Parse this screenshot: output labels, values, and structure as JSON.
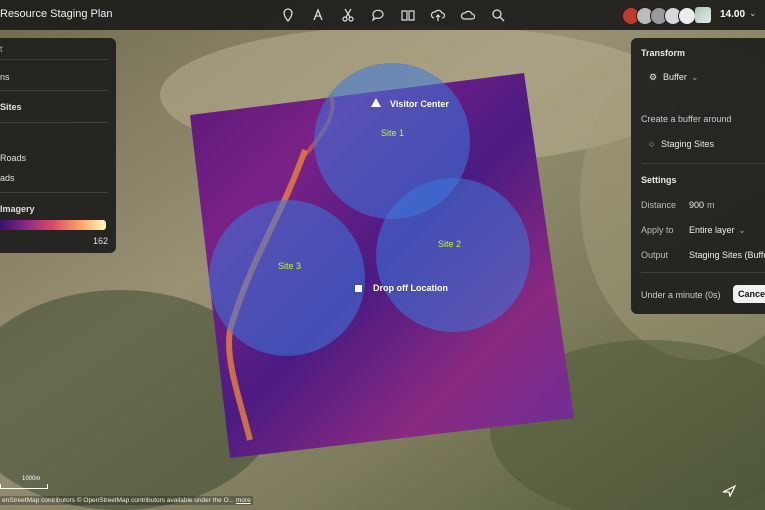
{
  "app": {
    "title": "Resource Staging Plan",
    "zoom": "14.00"
  },
  "toolbar": {
    "icons": [
      "pin-icon",
      "text-icon",
      "scissors-icon",
      "comment-icon",
      "book-icon",
      "upload-cloud-icon",
      "cloud-icon",
      "search-icon"
    ]
  },
  "left_panel": {
    "rows": [
      {
        "label": "t"
      },
      {
        "label": "ns"
      },
      {
        "label": "Sites"
      },
      {
        "label": "Roads"
      },
      {
        "label": "ads"
      },
      {
        "label": "Imagery"
      }
    ],
    "legend_max": "162"
  },
  "right_panel": {
    "heading": "Transform",
    "tool": "Buffer",
    "description": "Create a buffer around",
    "layer": "Staging Sites",
    "settings_heading": "Settings",
    "distance_label": "Distance",
    "distance_value": "900",
    "distance_unit": "m",
    "apply_label": "Apply to",
    "apply_value": "Entire layer",
    "output_label": "Output",
    "output_value": "Staging Sites (Buffe",
    "eta": "Under a minute (0s)",
    "cancel": "Cance"
  },
  "map": {
    "labels": {
      "visitor_center": "Visitor Center",
      "site1": "Site 1",
      "site2": "Site 2",
      "site3": "Site 3",
      "dropoff": "Drop off Location"
    },
    "scale": "1000m",
    "attribution": "enStreetMap contributors  © OpenStreetMap contributors available under the O...",
    "attribution_more": "more"
  },
  "colors": {
    "site_label": "#c6f23a",
    "buffer_fill": "#3c78dc",
    "panel_bg": "#1e1e1c"
  }
}
